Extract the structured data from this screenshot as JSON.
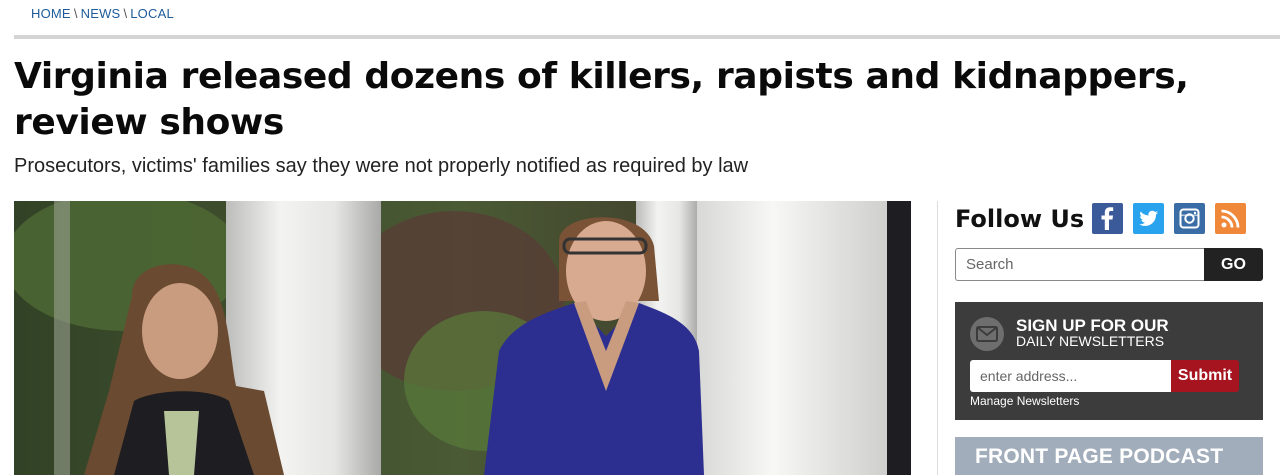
{
  "breadcrumb": {
    "home": "HOME",
    "news": "NEWS",
    "local": "LOCAL",
    "separator": "\\"
  },
  "article": {
    "headline": "Virginia released dozens of killers, rapists and kidnappers, review shows",
    "subheadline": "Prosecutors, victims' families say they were not properly notified as required by law"
  },
  "sidebar": {
    "follow_label": "Follow Us",
    "social_icons": [
      "facebook-icon",
      "twitter-icon",
      "instagram-icon",
      "rss-icon"
    ],
    "search": {
      "placeholder": "Search",
      "button_label": "GO"
    },
    "newsletter": {
      "title": "SIGN UP FOR OUR",
      "subtitle": "DAILY NEWSLETTERS",
      "placeholder": "enter address...",
      "button_label": "Submit",
      "manage_link": "Manage Newsletters"
    },
    "podcast": {
      "title": "FRONT PAGE PODCAST"
    }
  },
  "colors": {
    "link": "#1d5c99",
    "facebook": "#3b5a9a",
    "twitter": "#2aa3ef",
    "instagram": "#3a6da6",
    "rss": "#f0883a",
    "submit": "#a6151f",
    "newsletter_bg": "#3c3c3c",
    "podcast_bg": "#a2adbb"
  }
}
